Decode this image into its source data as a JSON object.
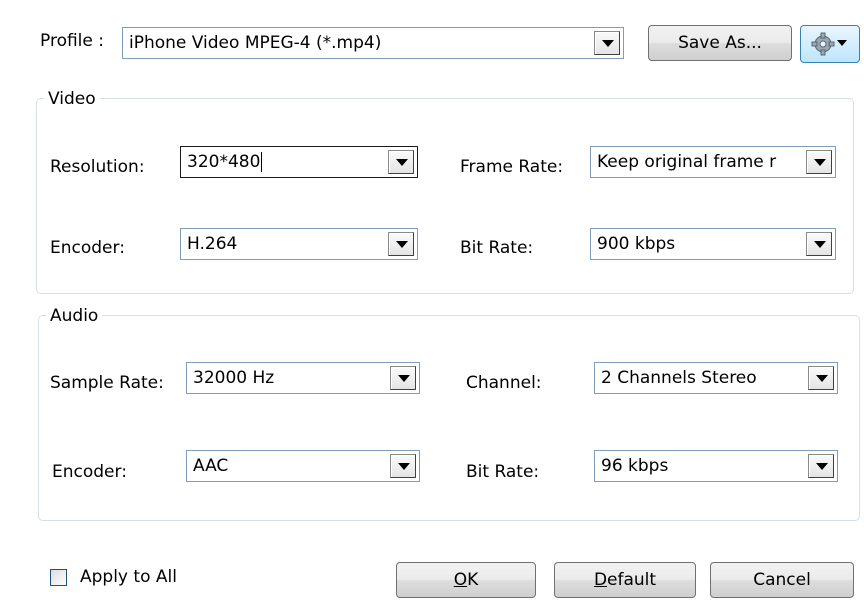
{
  "profile": {
    "label": "Profile :",
    "value": "iPhone Video MPEG-4 (*.mp4)",
    "save_as_label": "Save As...",
    "settings_icon": "gear-dropdown-icon"
  },
  "video": {
    "legend": "Video",
    "resolution_label": "Resolution:",
    "resolution_value": "320*480",
    "frame_rate_label": "Frame Rate:",
    "frame_rate_value": "Keep original frame r",
    "encoder_label": "Encoder:",
    "encoder_value": "H.264",
    "bit_rate_label": "Bit Rate:",
    "bit_rate_value": "900 kbps"
  },
  "audio": {
    "legend": "Audio",
    "sample_rate_label": "Sample Rate:",
    "sample_rate_value": "32000 Hz",
    "channel_label": "Channel:",
    "channel_value": "2 Channels Stereo",
    "encoder_label": "Encoder:",
    "encoder_value": "AAC",
    "bit_rate_label": "Bit Rate:",
    "bit_rate_value": "96 kbps"
  },
  "footer": {
    "apply_to_all_label": "Apply to All",
    "apply_to_all_checked": false,
    "ok_mnemonic": "O",
    "ok_rest": "K",
    "default_mnemonic": "D",
    "default_rest": "efault",
    "cancel_label": "Cancel"
  }
}
